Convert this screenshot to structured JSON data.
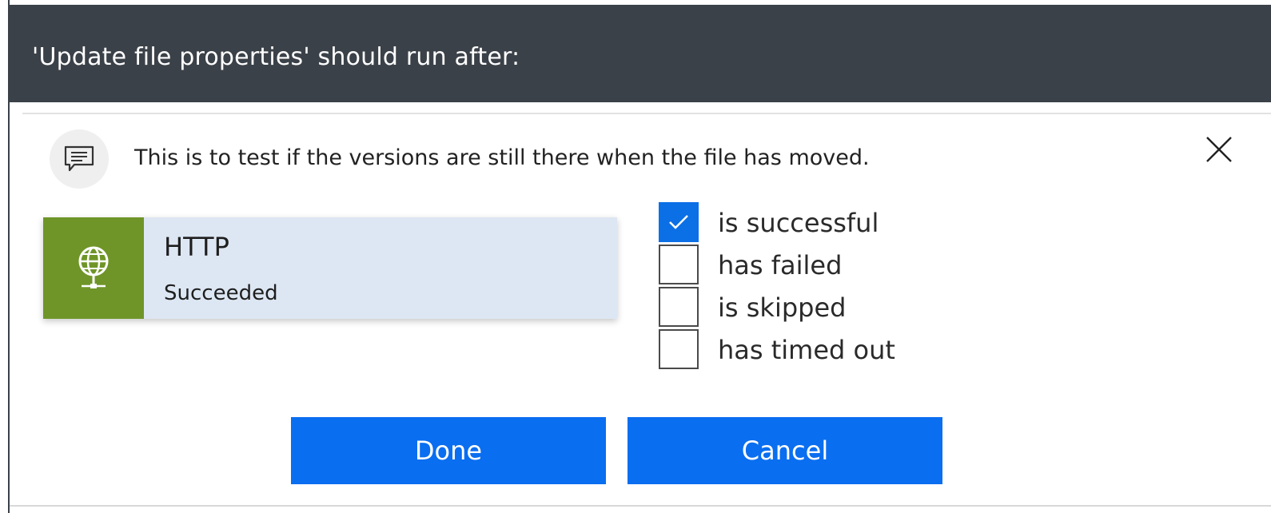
{
  "dialog": {
    "title": "'Update file properties' should run after:",
    "comment": "This is to test if the versions are still there when the file has moved."
  },
  "action": {
    "name": "HTTP",
    "status": "Succeeded",
    "icon": "globe-icon",
    "accent_color": "#6f9528",
    "card_color": "#dde7f3"
  },
  "conditions": [
    {
      "label": "is successful",
      "checked": true
    },
    {
      "label": "has failed",
      "checked": false
    },
    {
      "label": "is skipped",
      "checked": false
    },
    {
      "label": "has timed out",
      "checked": false
    }
  ],
  "buttons": {
    "done": "Done",
    "cancel": "Cancel",
    "color": "#0a6ef0"
  },
  "header_color": "#3b4148"
}
